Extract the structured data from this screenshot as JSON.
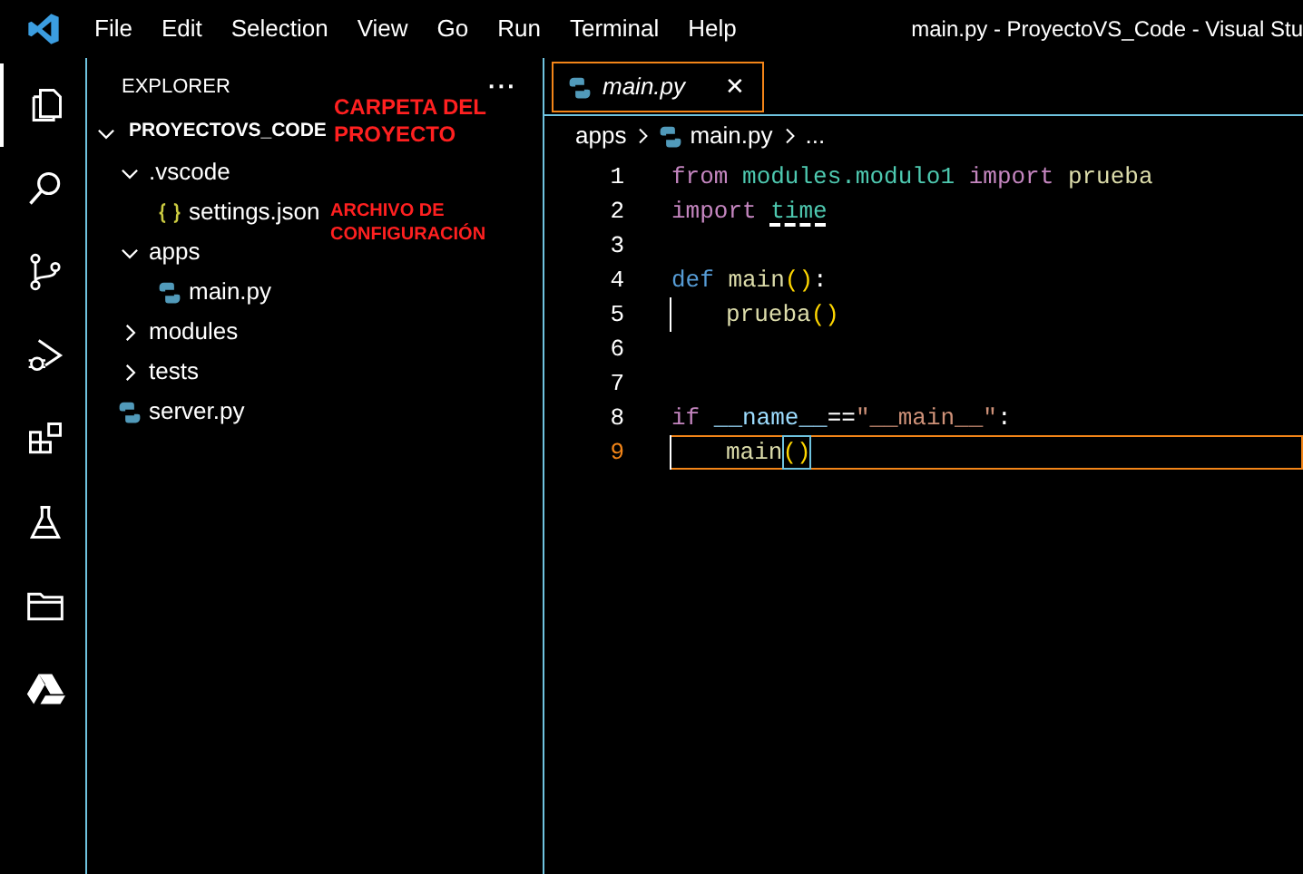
{
  "menu": [
    "File",
    "Edit",
    "Selection",
    "View",
    "Go",
    "Run",
    "Terminal",
    "Help"
  ],
  "window": {
    "title": "main.py - ProyectoVS_Code - Visual Stu"
  },
  "activity_bar": [
    {
      "kind": "files",
      "selected": true
    },
    {
      "kind": "search",
      "selected": false
    },
    {
      "kind": "source-control",
      "selected": false
    },
    {
      "kind": "run-debug",
      "selected": false
    },
    {
      "kind": "extensions",
      "selected": false
    },
    {
      "kind": "flask",
      "selected": false
    },
    {
      "kind": "folder",
      "selected": false
    },
    {
      "kind": "drive",
      "selected": false
    }
  ],
  "sidebar": {
    "title": "EXPLORER",
    "more": "···",
    "tree": [
      {
        "label": "PROYECTOVS_CODE",
        "kind": "root",
        "expanded": true,
        "children": [
          {
            "label": ".vscode",
            "kind": "folder",
            "expanded": true,
            "children": [
              {
                "label": "settings.json",
                "kind": "json"
              }
            ]
          },
          {
            "label": "apps",
            "kind": "folder",
            "expanded": true,
            "children": [
              {
                "label": "main.py",
                "kind": "python"
              }
            ]
          },
          {
            "label": "modules",
            "kind": "folder",
            "expanded": false
          },
          {
            "label": "tests",
            "kind": "folder",
            "expanded": false
          },
          {
            "label": "server.py",
            "kind": "python"
          }
        ]
      }
    ],
    "annotations": [
      {
        "lines": [
          "CARPETA DEL",
          "PROYECTO"
        ],
        "kind": "folder-note"
      },
      {
        "lines": [
          "ARCHIVO DE",
          "CONFIGURACIÓN"
        ],
        "kind": "file-note"
      }
    ]
  },
  "tabs": [
    {
      "label": "main.py",
      "close": "✕",
      "selected": true
    }
  ],
  "breadcrumb": [
    {
      "label": "apps",
      "kind": "folder"
    },
    {
      "label": "main.py",
      "kind": "python"
    },
    {
      "label": "...",
      "kind": "more"
    }
  ],
  "editor": {
    "lines": [
      {
        "number": "1",
        "current": false,
        "tokens": [
          {
            "text": "from",
            "kind": "control"
          },
          {
            "text": "modules.modulo1",
            "kind": "module",
            "space": true
          },
          {
            "text": "import",
            "kind": "control",
            "space": true
          },
          {
            "text": "prueba",
            "kind": "function",
            "space": true
          }
        ]
      },
      {
        "number": "2",
        "current": false,
        "tokens": [
          {
            "text": "import",
            "kind": "control"
          },
          {
            "text": "time",
            "kind": "module",
            "space": true,
            "warning": true
          }
        ]
      },
      {
        "number": "3",
        "current": false
      },
      {
        "number": "4",
        "current": false,
        "tokens": [
          {
            "text": "def",
            "kind": "storage"
          },
          {
            "text": "main",
            "kind": "function",
            "space": true
          },
          {
            "text": "()",
            "kind": "paren"
          },
          {
            "text": ":",
            "kind": "plain"
          }
        ]
      },
      {
        "number": "5",
        "current": false,
        "indented": true,
        "tokens": [
          {
            "text": "prueba",
            "kind": "function"
          },
          {
            "text": "()",
            "kind": "paren"
          }
        ]
      },
      {
        "number": "6",
        "current": false
      },
      {
        "number": "7",
        "current": false
      },
      {
        "number": "8",
        "current": false,
        "tokens": [
          {
            "text": "if",
            "kind": "control"
          },
          {
            "text": "__name__",
            "kind": "variable",
            "space": true
          },
          {
            "text": "==",
            "kind": "plain"
          },
          {
            "text": "\"__main__\"",
            "kind": "string"
          },
          {
            "text": ":",
            "kind": "plain"
          }
        ]
      },
      {
        "number": "9",
        "current": true,
        "indented": true,
        "tokens": [
          {
            "text": "main",
            "kind": "function"
          },
          {
            "text": "()",
            "kind": "paren",
            "matched": true
          }
        ]
      }
    ]
  }
}
